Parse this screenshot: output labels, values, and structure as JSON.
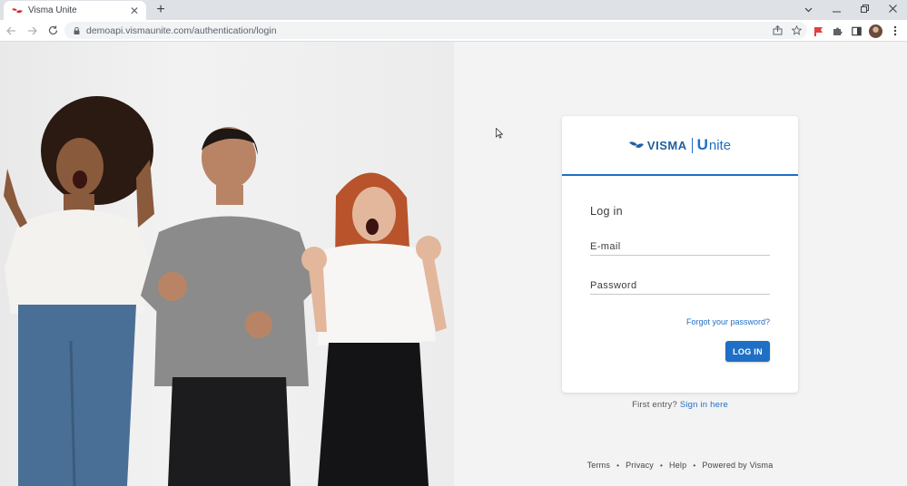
{
  "browser": {
    "tab_title": "Visma Unite",
    "tab_close": "✕",
    "new_tab": "+",
    "url": "demoapi.vismaunite.com/authentication/login"
  },
  "brand": {
    "visma": "VISMA",
    "unite_u": "U",
    "unite_rest": "nite",
    "accent_color": "#1f6fc5"
  },
  "login": {
    "title": "Log in",
    "email_placeholder": "E-mail",
    "password_placeholder": "Password",
    "forgot_link": "Forgot your password?",
    "login_button": "LOG IN"
  },
  "first_entry": {
    "text": "First entry?",
    "link": "Sign in here"
  },
  "footer": {
    "links": [
      "Terms",
      "Privacy",
      "Help",
      "Powered by Visma"
    ],
    "separator": "•"
  },
  "icons": {
    "back": "back-arrow-icon",
    "forward": "forward-arrow-icon",
    "reload": "reload-icon",
    "lock": "lock-icon",
    "share": "share-icon",
    "bookmark": "star-icon",
    "extensions": "puzzle-icon",
    "side_panel": "side-panel-icon",
    "menu": "kebab-menu-icon"
  }
}
